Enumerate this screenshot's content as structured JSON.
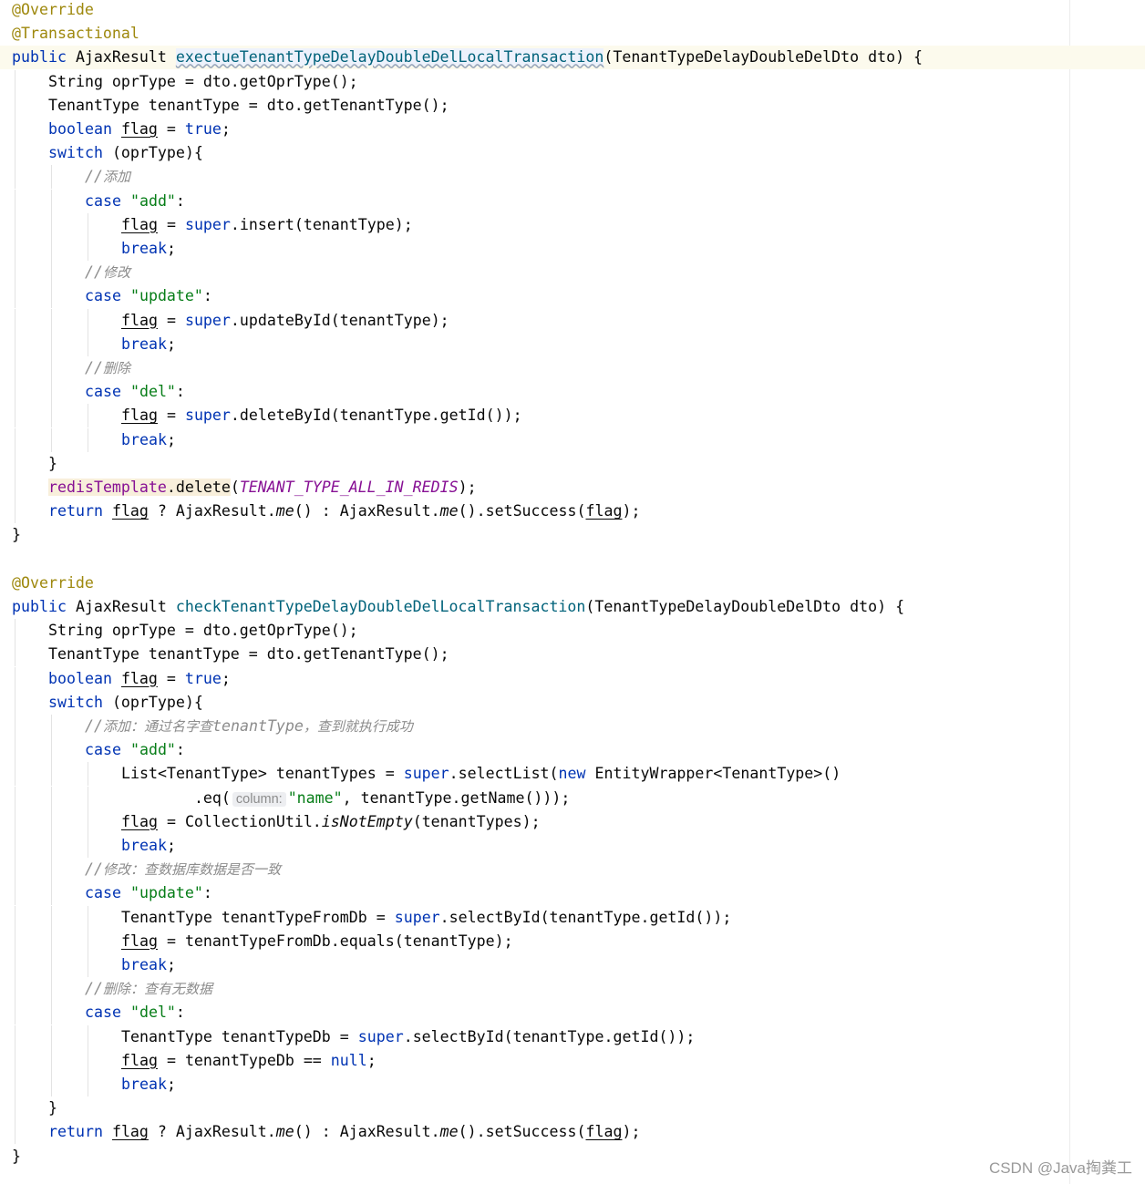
{
  "editor": {
    "lines": [
      {
        "tokens": [
          {
            "t": "@Override",
            "c": "ann"
          }
        ]
      },
      {
        "tokens": [
          {
            "t": "@Transactional",
            "c": "ann"
          }
        ]
      },
      {
        "current": true,
        "tokens": [
          {
            "t": "public",
            "c": "kw"
          },
          {
            "t": " AjaxResult "
          },
          {
            "t": "exectueTenantTypeDelayDoubleDelLocalTransaction",
            "c": "mdecl-warn"
          },
          {
            "t": "(TenantTypeDelayDoubleDelDto dto) {"
          }
        ]
      },
      {
        "indent": 1,
        "tokens": [
          {
            "t": "String oprType = dto.getOprType();"
          }
        ]
      },
      {
        "indent": 1,
        "tokens": [
          {
            "t": "TenantType tenantType = dto.getTenantType();"
          }
        ]
      },
      {
        "indent": 1,
        "tokens": [
          {
            "t": "boolean",
            "c": "kw"
          },
          {
            "t": " "
          },
          {
            "t": "flag",
            "c": "var"
          },
          {
            "t": " = "
          },
          {
            "t": "true",
            "c": "kw"
          },
          {
            "t": ";"
          }
        ]
      },
      {
        "indent": 1,
        "tokens": [
          {
            "t": "switch",
            "c": "kw"
          },
          {
            "t": " (oprType){"
          }
        ]
      },
      {
        "indent": 2,
        "tokens": [
          {
            "t": "//",
            "c": "cmt"
          },
          {
            "t": "添加",
            "c": "cmt-cjk"
          }
        ]
      },
      {
        "indent": 2,
        "tokens": [
          {
            "t": "case",
            "c": "kw"
          },
          {
            "t": " "
          },
          {
            "t": "\"add\"",
            "c": "str"
          },
          {
            "t": ":"
          }
        ]
      },
      {
        "indent": 3,
        "tokens": [
          {
            "t": "flag",
            "c": "var"
          },
          {
            "t": " = "
          },
          {
            "t": "super",
            "c": "kw"
          },
          {
            "t": ".insert(tenantType);"
          }
        ]
      },
      {
        "indent": 3,
        "tokens": [
          {
            "t": "break",
            "c": "kw"
          },
          {
            "t": ";"
          }
        ]
      },
      {
        "indent": 2,
        "tokens": [
          {
            "t": "//",
            "c": "cmt"
          },
          {
            "t": "修改",
            "c": "cmt-cjk"
          }
        ]
      },
      {
        "indent": 2,
        "tokens": [
          {
            "t": "case",
            "c": "kw"
          },
          {
            "t": " "
          },
          {
            "t": "\"update\"",
            "c": "str"
          },
          {
            "t": ":"
          }
        ]
      },
      {
        "indent": 3,
        "tokens": [
          {
            "t": "flag",
            "c": "var"
          },
          {
            "t": " = "
          },
          {
            "t": "super",
            "c": "kw"
          },
          {
            "t": ".updateById(tenantType);"
          }
        ]
      },
      {
        "indent": 3,
        "tokens": [
          {
            "t": "break",
            "c": "kw"
          },
          {
            "t": ";"
          }
        ]
      },
      {
        "indent": 2,
        "tokens": [
          {
            "t": "//",
            "c": "cmt"
          },
          {
            "t": "删除",
            "c": "cmt-cjk"
          }
        ]
      },
      {
        "indent": 2,
        "tokens": [
          {
            "t": "case",
            "c": "kw"
          },
          {
            "t": " "
          },
          {
            "t": "\"del\"",
            "c": "str"
          },
          {
            "t": ":"
          }
        ]
      },
      {
        "indent": 3,
        "tokens": [
          {
            "t": "flag",
            "c": "var"
          },
          {
            "t": " = "
          },
          {
            "t": "super",
            "c": "kw"
          },
          {
            "t": ".deleteById(tenantType.getId());"
          }
        ]
      },
      {
        "indent": 3,
        "tokens": [
          {
            "t": "break",
            "c": "kw"
          },
          {
            "t": ";"
          }
        ]
      },
      {
        "indent": 1,
        "tokens": [
          {
            "t": "}"
          }
        ]
      },
      {
        "indent": 1,
        "tokens": [
          {
            "t": "redisTemplate",
            "c": "field-hl"
          },
          {
            "t": ".delete",
            "c": "hl"
          },
          {
            "t": "("
          },
          {
            "t": "TENANT_TYPE_ALL_IN_REDIS",
            "c": "const"
          },
          {
            "t": ");"
          }
        ]
      },
      {
        "indent": 1,
        "tokens": [
          {
            "t": "return",
            "c": "kw"
          },
          {
            "t": " "
          },
          {
            "t": "flag",
            "c": "var"
          },
          {
            "t": " ? AjaxResult."
          },
          {
            "t": "me",
            "c": "static"
          },
          {
            "t": "() : AjaxResult."
          },
          {
            "t": "me",
            "c": "static"
          },
          {
            "t": "().setSuccess("
          },
          {
            "t": "flag",
            "c": "var"
          },
          {
            "t": ");"
          }
        ]
      },
      {
        "tokens": [
          {
            "t": "}"
          }
        ]
      },
      {
        "tokens": []
      },
      {
        "tokens": [
          {
            "t": "@Override",
            "c": "ann"
          }
        ]
      },
      {
        "tokens": [
          {
            "t": "public",
            "c": "kw"
          },
          {
            "t": " AjaxResult "
          },
          {
            "t": "checkTenantTypeDelayDoubleDelLocalTransaction",
            "c": "mdecl"
          },
          {
            "t": "(TenantTypeDelayDoubleDelDto dto) {"
          }
        ]
      },
      {
        "indent": 1,
        "tokens": [
          {
            "t": "String oprType = dto.getOprType();"
          }
        ]
      },
      {
        "indent": 1,
        "tokens": [
          {
            "t": "TenantType tenantType = dto.getTenantType();"
          }
        ]
      },
      {
        "indent": 1,
        "tokens": [
          {
            "t": "boolean",
            "c": "kw"
          },
          {
            "t": " "
          },
          {
            "t": "flag",
            "c": "var"
          },
          {
            "t": " = "
          },
          {
            "t": "true",
            "c": "kw"
          },
          {
            "t": ";"
          }
        ]
      },
      {
        "indent": 1,
        "tokens": [
          {
            "t": "switch",
            "c": "kw"
          },
          {
            "t": " (oprType){"
          }
        ]
      },
      {
        "indent": 2,
        "tokens": [
          {
            "t": "//",
            "c": "cmt"
          },
          {
            "t": "添加：通过名字查",
            "c": "cmt-cjk"
          },
          {
            "t": "tenantType",
            "c": "cmt"
          },
          {
            "t": "，查到就执行成功",
            "c": "cmt-cjk"
          }
        ]
      },
      {
        "indent": 2,
        "tokens": [
          {
            "t": "case",
            "c": "kw"
          },
          {
            "t": " "
          },
          {
            "t": "\"add\"",
            "c": "str"
          },
          {
            "t": ":"
          }
        ]
      },
      {
        "indent": 3,
        "tokens": [
          {
            "t": "List<TenantType> tenantTypes = "
          },
          {
            "t": "super",
            "c": "kw"
          },
          {
            "t": ".selectList("
          },
          {
            "t": "new",
            "c": "kw"
          },
          {
            "t": " EntityWrapper<TenantType>()"
          }
        ]
      },
      {
        "indent": 3,
        "extra": "        ",
        "tokens": [
          {
            "t": ".eq("
          },
          {
            "t": "column:",
            "c": "hint"
          },
          {
            "t": "\"name\"",
            "c": "str"
          },
          {
            "t": ", tenantType.getName()));"
          }
        ]
      },
      {
        "indent": 3,
        "tokens": [
          {
            "t": "flag",
            "c": "var"
          },
          {
            "t": " = CollectionUtil."
          },
          {
            "t": "isNotEmpty",
            "c": "static"
          },
          {
            "t": "(tenantTypes);"
          }
        ]
      },
      {
        "indent": 3,
        "tokens": [
          {
            "t": "break",
            "c": "kw"
          },
          {
            "t": ";"
          }
        ]
      },
      {
        "indent": 2,
        "tokens": [
          {
            "t": "//",
            "c": "cmt"
          },
          {
            "t": "修改：查数据库数据是否一致",
            "c": "cmt-cjk"
          }
        ]
      },
      {
        "indent": 2,
        "tokens": [
          {
            "t": "case",
            "c": "kw"
          },
          {
            "t": " "
          },
          {
            "t": "\"update\"",
            "c": "str"
          },
          {
            "t": ":"
          }
        ]
      },
      {
        "indent": 3,
        "tokens": [
          {
            "t": "TenantType tenantTypeFromDb = "
          },
          {
            "t": "super",
            "c": "kw"
          },
          {
            "t": ".selectById(tenantType.getId());"
          }
        ]
      },
      {
        "indent": 3,
        "tokens": [
          {
            "t": "flag",
            "c": "var"
          },
          {
            "t": " = tenantTypeFromDb.equals(tenantType);"
          }
        ]
      },
      {
        "indent": 3,
        "tokens": [
          {
            "t": "break",
            "c": "kw"
          },
          {
            "t": ";"
          }
        ]
      },
      {
        "indent": 2,
        "tokens": [
          {
            "t": "//",
            "c": "cmt"
          },
          {
            "t": "删除：查有无数据",
            "c": "cmt-cjk"
          }
        ]
      },
      {
        "indent": 2,
        "tokens": [
          {
            "t": "case",
            "c": "kw"
          },
          {
            "t": " "
          },
          {
            "t": "\"del\"",
            "c": "str"
          },
          {
            "t": ":"
          }
        ]
      },
      {
        "indent": 3,
        "tokens": [
          {
            "t": "TenantType tenantTypeDb = "
          },
          {
            "t": "super",
            "c": "kw"
          },
          {
            "t": ".selectById(tenantType.getId());"
          }
        ]
      },
      {
        "indent": 3,
        "tokens": [
          {
            "t": "flag",
            "c": "var"
          },
          {
            "t": " = tenantTypeDb == "
          },
          {
            "t": "null",
            "c": "kw"
          },
          {
            "t": ";"
          }
        ]
      },
      {
        "indent": 3,
        "tokens": [
          {
            "t": "break",
            "c": "kw"
          },
          {
            "t": ";"
          }
        ]
      },
      {
        "indent": 1,
        "tokens": [
          {
            "t": "}"
          }
        ]
      },
      {
        "indent": 1,
        "tokens": [
          {
            "t": "return",
            "c": "kw"
          },
          {
            "t": " "
          },
          {
            "t": "flag",
            "c": "var"
          },
          {
            "t": " ? AjaxResult."
          },
          {
            "t": "me",
            "c": "static"
          },
          {
            "t": "() : AjaxResult."
          },
          {
            "t": "me",
            "c": "static"
          },
          {
            "t": "().setSuccess("
          },
          {
            "t": "flag",
            "c": "var"
          },
          {
            "t": ");"
          }
        ]
      },
      {
        "tokens": [
          {
            "t": "}"
          }
        ]
      }
    ]
  },
  "watermark": {
    "text": "CSDN @Java掏粪工"
  }
}
